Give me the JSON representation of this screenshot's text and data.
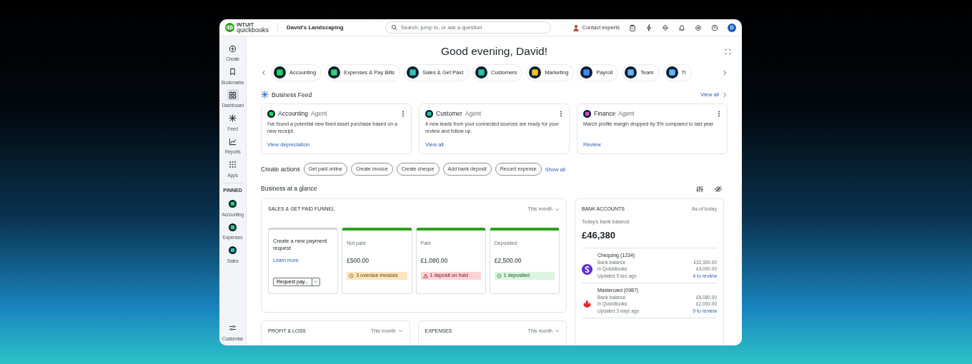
{
  "brand": {
    "maker": "INTUIT",
    "product": "quickbooks"
  },
  "topbar": {
    "company": "David's Landscaping",
    "search_placeholder": "Search, jump to, or ask a question",
    "contact": "Contact experts",
    "avatar": "D"
  },
  "sidebar": {
    "items": [
      {
        "label": "Create",
        "selected": false
      },
      {
        "label": "Bookmarks",
        "selected": false
      },
      {
        "label": "Dashboard",
        "selected": true
      },
      {
        "label": "Feed",
        "selected": false
      },
      {
        "label": "Reports",
        "selected": false
      },
      {
        "label": "Apps",
        "selected": false
      }
    ],
    "pinned_title": "PINNED",
    "pinned": [
      {
        "label": "Accounting",
        "color": "#1ed760"
      },
      {
        "label": "Expenses",
        "color": "#33d17a"
      },
      {
        "label": "Sales",
        "color": "#2fc4b2"
      }
    ],
    "customise": "Customise"
  },
  "greeting": "Good evening, David!",
  "categories": [
    {
      "label": "Accounting",
      "color": "#1ed760"
    },
    {
      "label": "Expenses & Pay Bills",
      "color": "#33d17a"
    },
    {
      "label": "Sales & Get Paid",
      "color": "#2fc4b2"
    },
    {
      "label": "Customers",
      "color": "#26c6a0"
    },
    {
      "label": "Marketing",
      "color": "#f5c518"
    },
    {
      "label": "Payroll",
      "color": "#3d8bfd"
    },
    {
      "label": "Team",
      "color": "#5fb7f5"
    },
    {
      "label": "Ti",
      "color": "#5fb7f5"
    }
  ],
  "feed": {
    "title": "Business Feed",
    "view_all": "View all",
    "agents": [
      {
        "name": "Accounting",
        "role": "Agent",
        "text": "I've found a potential new fixed asset purchase based on a new receipt.",
        "link": "View depreciation",
        "color": "#1ed760"
      },
      {
        "name": "Customer",
        "role": "Agent",
        "text": "4 new leads from your connected sources are ready for your review and follow up.",
        "link": "View all",
        "color": "#26c6a0"
      },
      {
        "name": "Finance",
        "role": "Agent",
        "text": "March profile margin dropped by 5% compared to last year",
        "link": "Review",
        "color": "#d946c8"
      }
    ]
  },
  "create_actions": {
    "label": "Create actions",
    "actions": [
      "Get paid online",
      "Create invoice",
      "Create cheque",
      "Add bank deposit",
      "Record expense"
    ],
    "show_all": "Show all"
  },
  "glance": {
    "title": "Business at a glance"
  },
  "funnel": {
    "title": "SALES & GET PAID FUNNEL",
    "period": "This month",
    "request": {
      "title": "Create a new payment request",
      "link": "Learn more",
      "button": "Request pay..."
    },
    "stages": [
      {
        "label": "Not paid",
        "amount": "£500.00",
        "status": "3 overdue invoices",
        "kind": "warning"
      },
      {
        "label": "Paid",
        "amount": "£1,080.00",
        "status": "1 deposit on hold",
        "kind": "danger"
      },
      {
        "label": "Deposited",
        "amount": "£2,500.00",
        "status": "1 deposited",
        "kind": "success"
      }
    ]
  },
  "bank": {
    "title": "BANK ACCOUNTS",
    "as_of": "As of today",
    "balance_label": "Today's bank balance",
    "balance": "£46,380",
    "accounts": [
      {
        "name": "Chequing (1234)",
        "bank_label": "Bank balance",
        "bank_value": "£32,300.00",
        "qb_label": "in QuickBooks",
        "qb_value": "£4,000.00",
        "updated": "Updated 5 sec ago",
        "review": "4 to review",
        "color": "#5b2bd6"
      },
      {
        "name": "Mastercard (0987)",
        "bank_label": "Bank balance",
        "bank_value": "£8,080.00",
        "qb_label": "in QuickBooks",
        "qb_value": "£2,000.00",
        "updated": "Updated 3 days ago",
        "review": "9 to review",
        "color": "#e3262b"
      }
    ]
  },
  "lower_cards": [
    {
      "title": "PROFIT & LOSS",
      "period": "This month"
    },
    {
      "title": "EXPENSES",
      "period": "This month"
    }
  ]
}
